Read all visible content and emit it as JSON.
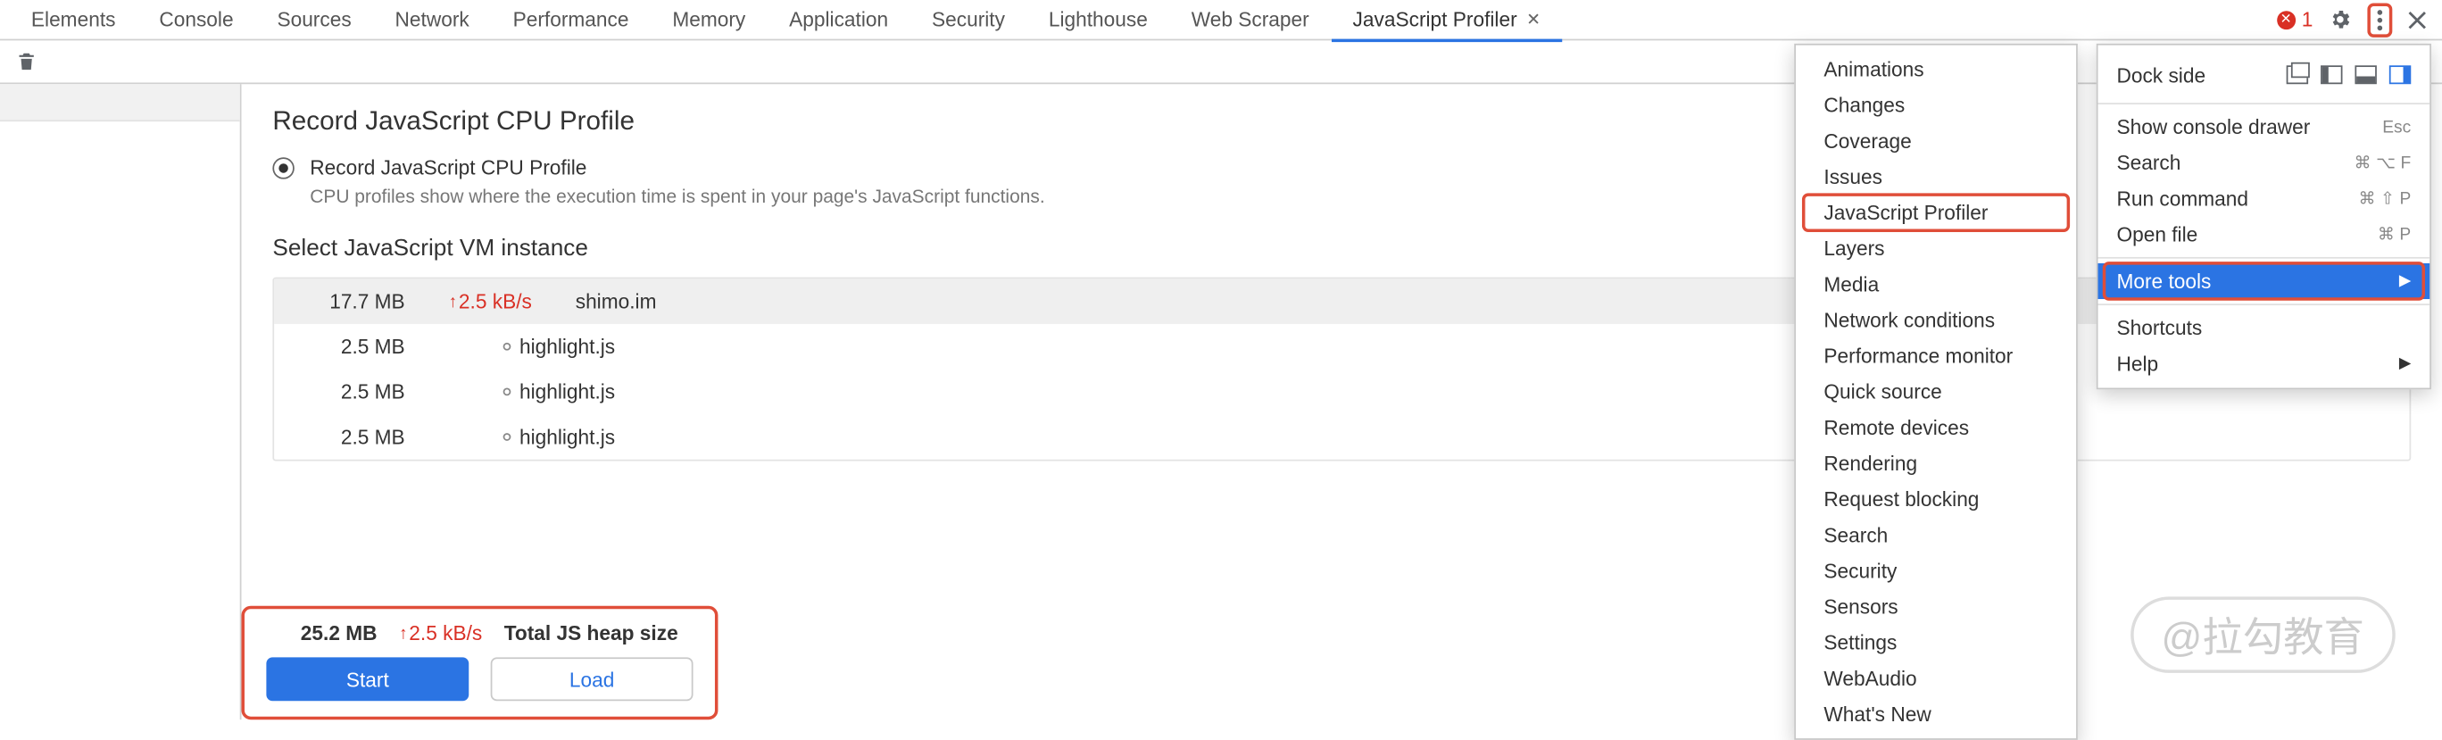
{
  "tabs": {
    "items": [
      "Elements",
      "Console",
      "Sources",
      "Network",
      "Performance",
      "Memory",
      "Application",
      "Security",
      "Lighthouse",
      "Web Scraper",
      "JavaScript Profiler"
    ],
    "active": "JavaScript Profiler"
  },
  "errors": {
    "count": "1"
  },
  "profile": {
    "title": "Record JavaScript CPU Profile",
    "option_label": "Record JavaScript CPU Profile",
    "description": "CPU profiles show where the execution time is spent in your page's JavaScript functions.",
    "vm_title": "Select JavaScript VM instance",
    "rows": [
      {
        "size": "17.7 MB",
        "rate": "2.5 kB/s",
        "name": "shimo.im",
        "selected": true,
        "hasRate": true,
        "child": false
      },
      {
        "size": "2.5 MB",
        "rate": "",
        "name": "highlight.js",
        "selected": false,
        "hasRate": false,
        "child": true
      },
      {
        "size": "2.5 MB",
        "rate": "",
        "name": "highlight.js",
        "selected": false,
        "hasRate": false,
        "child": true
      },
      {
        "size": "2.5 MB",
        "rate": "",
        "name": "highlight.js",
        "selected": false,
        "hasRate": false,
        "child": true
      }
    ],
    "total_size": "25.2 MB",
    "total_rate": "2.5 kB/s",
    "total_label": "Total JS heap size",
    "start": "Start",
    "load": "Load"
  },
  "more_tools_menu": {
    "items": [
      "Animations",
      "Changes",
      "Coverage",
      "Issues",
      "JavaScript Profiler",
      "Layers",
      "Media",
      "Network conditions",
      "Performance monitor",
      "Quick source",
      "Remote devices",
      "Rendering",
      "Request blocking",
      "Search",
      "Security",
      "Sensors",
      "Settings",
      "WebAudio",
      "What's New"
    ],
    "highlight": "JavaScript Profiler"
  },
  "main_menu": {
    "dock_label": "Dock side",
    "rows": [
      {
        "label": "Show console drawer",
        "shortcut": "Esc"
      },
      {
        "label": "Search",
        "shortcut": "⌘ ⌥ F"
      },
      {
        "label": "Run command",
        "shortcut": "⌘ ⇧ P"
      },
      {
        "label": "Open file",
        "shortcut": "⌘ P"
      },
      {
        "label": "More tools",
        "shortcut": "▶",
        "selected": true,
        "highlight": true
      },
      {
        "label": "Shortcuts",
        "shortcut": ""
      },
      {
        "label": "Help",
        "shortcut": "▶"
      }
    ]
  },
  "watermark": "@拉勾教育"
}
